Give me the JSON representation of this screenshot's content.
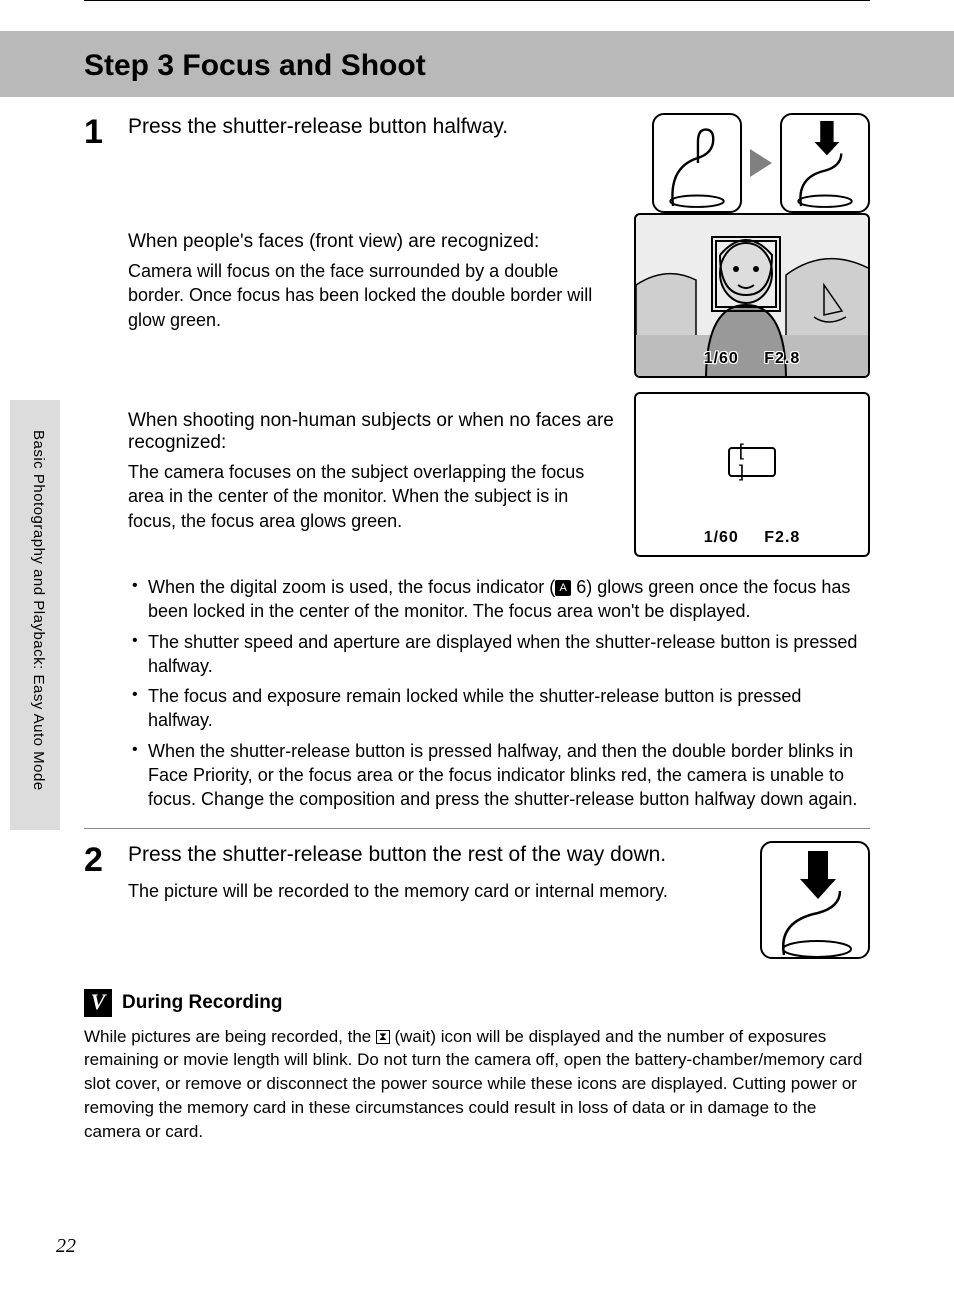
{
  "page_number": "22",
  "side_label": "Basic Photography and Playback: Easy Auto Mode",
  "header_title": "Step 3 Focus and Shoot",
  "step1": {
    "num": "1",
    "heading": "Press the shutter-release button halfway.",
    "sub1_heading": "When people's faces (front view) are recognized:",
    "sub1_body": "Camera will focus on the face surrounded by a double border. Once focus has been locked the double border will glow green.",
    "sub2_heading": "When shooting non-human subjects or when no faces are recognized:",
    "sub2_body": "The camera focuses on the subject overlapping the focus area in the center of the monitor. When the subject is in focus, the focus area glows green.",
    "bullets": [
      "When the digital zoom is used, the focus indicator (A 6) glows green once the focus has been locked in the center of the monitor. The focus area won't be displayed.",
      "The shutter speed and aperture are displayed when the shutter-release button is pressed halfway.",
      "The focus and exposure remain locked while the shutter-release button is pressed halfway.",
      "When the shutter-release button is pressed halfway, and then the double border blinks in Face Priority, or the focus area or the focus indicator blinks red, the camera is unable to focus. Change the composition and press the shutter-release button halfway down again."
    ],
    "lcd_shutter": "1/60",
    "lcd_aperture": "F2.8"
  },
  "step2": {
    "num": "2",
    "heading": "Press the shutter-release button the rest of the way down.",
    "body": "The picture will be recorded to the memory card or internal memory."
  },
  "note": {
    "icon_glyph": "V",
    "title": "During Recording",
    "body_pre": "While pictures are being recorded, the ",
    "wait_glyph": "⧗",
    "body_post": " (wait) icon will be displayed and the number of exposures remaining or movie length will blink. Do not turn the camera off, open the battery-chamber/memory card slot cover, or remove or disconnect the power source while these icons are displayed. Cutting power or removing the memory card in these circumstances could result in loss of data or in damage to the camera or card."
  }
}
